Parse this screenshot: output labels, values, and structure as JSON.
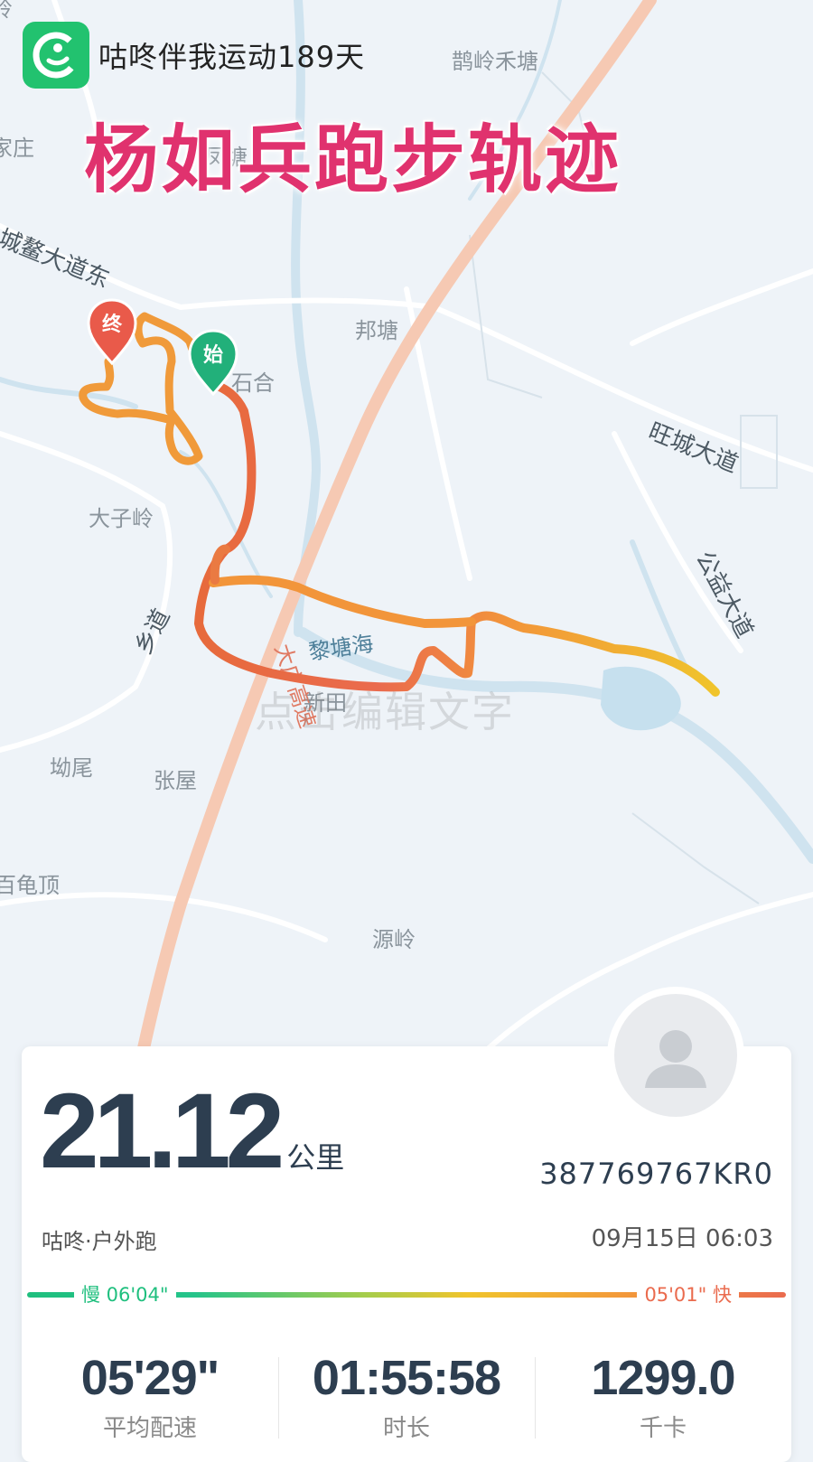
{
  "header": {
    "app_banner": "咕咚伴我运动189天",
    "title": "杨如兵跑步轨迹"
  },
  "map": {
    "place_labels": [
      "岭",
      "鹊岭禾塘",
      "家庄",
      "凤塘",
      "邦塘",
      "石合",
      "大子岭",
      "坳尾",
      "张屋",
      "百龟顶",
      "源岭",
      "新田"
    ],
    "road_labels": [
      "城鳌大道东",
      "旺城大道",
      "公益大道",
      "乡道"
    ],
    "highway_label": "大广高速",
    "water_label": "黎塘海",
    "start_marker": "始",
    "end_marker": "终",
    "watermark": "点击编辑文字"
  },
  "summary": {
    "distance": "21.12",
    "distance_unit": "公里",
    "user_id": "387769767KR0",
    "source": "咕咚·户外跑",
    "datetime": "09月15日 06:03",
    "pace_slow_label": "慢 06'04\"",
    "pace_fast_label": "05'01\" 快",
    "pace_colors": [
      "#1fbf7e",
      "#f0c42c",
      "#ea6b4e"
    ]
  },
  "stats": [
    {
      "value": "05'29\"",
      "label": "平均配速"
    },
    {
      "value": "01:55:58",
      "label": "时长"
    },
    {
      "value": "1299.0",
      "label": "千卡"
    }
  ]
}
